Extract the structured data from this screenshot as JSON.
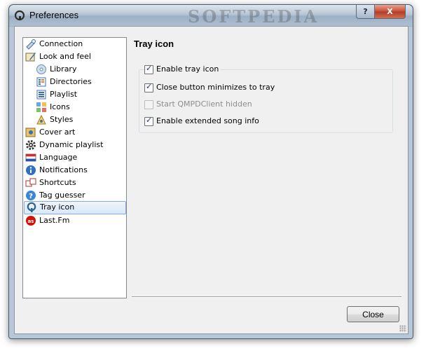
{
  "window": {
    "title": "Preferences",
    "watermark": "SOFTPEDIA",
    "help_glyph": "?",
    "close_glyph": "X"
  },
  "sidebar": {
    "items": [
      {
        "label": "Connection",
        "icon": "connection-icon",
        "level": 0
      },
      {
        "label": "Look and feel",
        "icon": "look-and-feel-icon",
        "level": 0
      },
      {
        "label": "Library",
        "icon": "library-icon",
        "level": 1
      },
      {
        "label": "Directories",
        "icon": "directories-icon",
        "level": 1
      },
      {
        "label": "Playlist",
        "icon": "playlist-icon",
        "level": 1
      },
      {
        "label": "Icons",
        "icon": "icons-icon",
        "level": 1
      },
      {
        "label": "Styles",
        "icon": "styles-icon",
        "level": 1
      },
      {
        "label": "Cover art",
        "icon": "cover-art-icon",
        "level": 0
      },
      {
        "label": "Dynamic playlist",
        "icon": "gear-icon",
        "level": 0
      },
      {
        "label": "Language",
        "icon": "language-flag-icon",
        "level": 0
      },
      {
        "label": "Notifications",
        "icon": "info-icon",
        "level": 0
      },
      {
        "label": "Shortcuts",
        "icon": "shortcuts-icon",
        "level": 0
      },
      {
        "label": "Tag guesser",
        "icon": "question-icon",
        "level": 0
      },
      {
        "label": "Tray icon",
        "icon": "tray-icon",
        "level": 0,
        "selected": true
      },
      {
        "label": "Last.Fm",
        "icon": "lastfm-icon",
        "level": 0
      }
    ]
  },
  "page": {
    "title": "Tray icon",
    "options": [
      {
        "label": "Enable tray icon",
        "checked": true,
        "enabled": true
      },
      {
        "label": "Close button minimizes to tray",
        "checked": true,
        "enabled": true
      },
      {
        "label": "Start QMPDClient hidden",
        "checked": false,
        "enabled": false
      },
      {
        "label": "Enable extended song info",
        "checked": true,
        "enabled": true
      }
    ]
  },
  "footer": {
    "close_label": "Close"
  },
  "colors": {
    "selection_border": "#84acdd",
    "selection_fill": "#d9e8f8",
    "close_button_red": "#c74a36",
    "accent": "#2c628b"
  }
}
